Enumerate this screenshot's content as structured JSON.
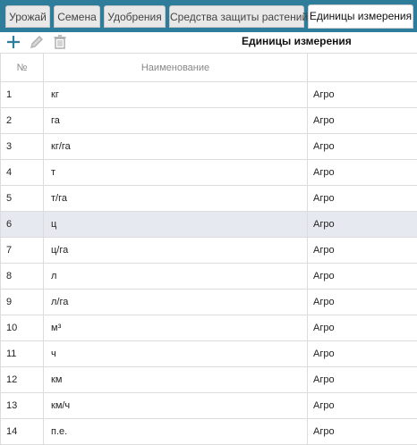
{
  "tabs": [
    {
      "label": "Урожай"
    },
    {
      "label": "Семена"
    },
    {
      "label": "Удобрения"
    },
    {
      "label": "Средства защиты растений"
    },
    {
      "label": "Единицы измерения"
    }
  ],
  "toolbar": {
    "title": "Единицы измерения",
    "add_icon": "plus-icon",
    "edit_icon": "pencil-icon",
    "delete_icon": "trash-icon"
  },
  "table": {
    "headers": [
      "№",
      "Наименование",
      ""
    ],
    "rows": [
      {
        "num": "1",
        "name": "кг",
        "source": "Агро"
      },
      {
        "num": "2",
        "name": "га",
        "source": "Агро"
      },
      {
        "num": "3",
        "name": "кг/га",
        "source": "Агро"
      },
      {
        "num": "4",
        "name": "т",
        "source": "Агро"
      },
      {
        "num": "5",
        "name": "т/га",
        "source": "Агро"
      },
      {
        "num": "6",
        "name": "ц",
        "source": "Агро"
      },
      {
        "num": "7",
        "name": "ц/га",
        "source": "Агро"
      },
      {
        "num": "8",
        "name": "л",
        "source": "Агро"
      },
      {
        "num": "9",
        "name": "л/га",
        "source": "Агро"
      },
      {
        "num": "10",
        "name": "м³",
        "source": "Агро"
      },
      {
        "num": "11",
        "name": "ч",
        "source": "Агро"
      },
      {
        "num": "12",
        "name": "км",
        "source": "Агро"
      },
      {
        "num": "13",
        "name": "км/ч",
        "source": "Агро"
      },
      {
        "num": "14",
        "name": "п.е.",
        "source": "Агро"
      }
    ]
  },
  "colors": {
    "tabbar": "#2e7d9a",
    "selected_row": "#e6e9ef"
  }
}
